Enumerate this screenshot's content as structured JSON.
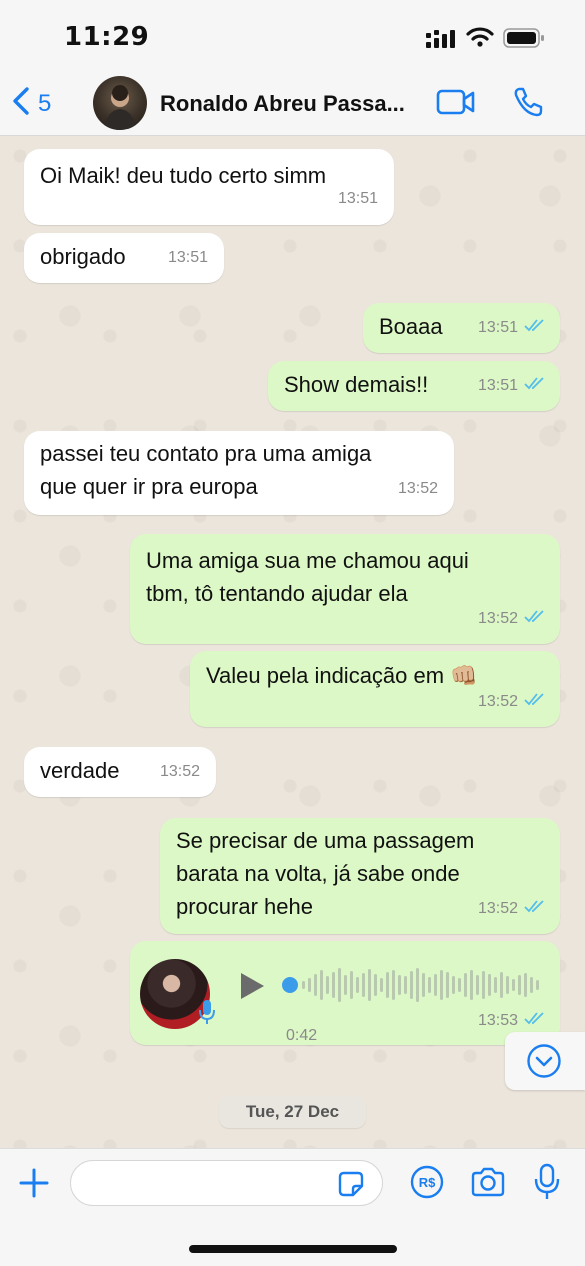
{
  "status_bar": {
    "time": "11:29"
  },
  "header": {
    "back_count": "5",
    "contact_name": "Ronaldo Abreu Passa..."
  },
  "messages": [
    {
      "dir": "in",
      "text": "Oi Maik! deu tudo certo simm",
      "time": "13:51"
    },
    {
      "dir": "in",
      "text": "obrigado",
      "time": "13:51"
    },
    {
      "dir": "out",
      "text": "Boaaa",
      "time": "13:51",
      "read": true
    },
    {
      "dir": "out",
      "text": "Show demais!!",
      "time": "13:51",
      "read": true
    },
    {
      "dir": "in",
      "lines": [
        "passei teu contato pra uma amiga",
        "que quer ir pra europa"
      ],
      "time": "13:52"
    },
    {
      "dir": "out",
      "lines": [
        "Uma amiga sua me chamou aqui",
        "tbm, tô tentando ajudar ela"
      ],
      "time": "13:52",
      "read": true
    },
    {
      "dir": "out",
      "text": "Valeu pela indicação em 👊🏼",
      "time": "13:52",
      "read": true
    },
    {
      "dir": "in",
      "text": "verdade",
      "time": "13:52"
    },
    {
      "dir": "out",
      "lines": [
        "Se precisar de uma passagem",
        "barata na volta, já sabe onde",
        "procurar hehe"
      ],
      "time": "13:52",
      "read": true
    },
    {
      "dir": "out",
      "type": "voice",
      "duration": "0:42",
      "time": "13:53",
      "read": true,
      "progress": 0.0
    }
  ],
  "date_chip": "Tue, 27 Dec",
  "input": {
    "value": "",
    "placeholder": ""
  },
  "icons": {
    "back": "chevron-left-icon",
    "video": "video-camera-icon",
    "call": "phone-icon",
    "plus": "plus-icon",
    "sticker": "sticker-icon",
    "payment": "rs-currency-icon",
    "camera": "camera-icon",
    "mic": "microphone-icon",
    "scroll": "chevron-down-circle-icon"
  },
  "colors": {
    "accent": "#1a7ef0",
    "outgoing_bubble": "#dcf8c6",
    "incoming_bubble": "#ffffff",
    "read_ticks": "#53bdeb",
    "voice_dot": "#3b9dea"
  }
}
